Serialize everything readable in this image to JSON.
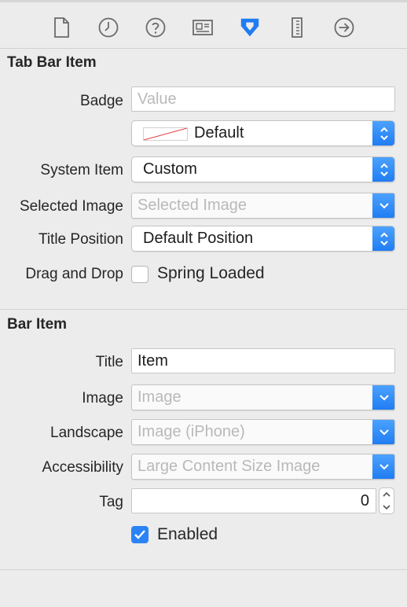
{
  "toolbar": {
    "icons": [
      "file-icon",
      "clock-icon",
      "help-icon",
      "identity-icon",
      "attributes-icon",
      "ruler-icon",
      "connections-icon"
    ],
    "active": "attributes-icon",
    "accent": "#1f7cf2"
  },
  "tab_bar_item": {
    "title": "Tab Bar Item",
    "badge_label": "Badge",
    "badge_placeholder": "Value",
    "badge_color_value": "Default",
    "system_item_label": "System Item",
    "system_item_value": "Custom",
    "selected_image_label": "Selected Image",
    "selected_image_placeholder": "Selected Image",
    "title_position_label": "Title Position",
    "title_position_value": "Default Position",
    "drag_drop_label": "Drag and Drop",
    "spring_loaded_label": "Spring Loaded",
    "spring_loaded_checked": false
  },
  "bar_item": {
    "title": "Bar Item",
    "title_label": "Title",
    "title_value": "Item",
    "image_label": "Image",
    "image_placeholder": "Image",
    "landscape_label": "Landscape",
    "landscape_placeholder": "Image (iPhone)",
    "accessibility_label": "Accessibility",
    "accessibility_placeholder": "Large Content Size Image",
    "tag_label": "Tag",
    "tag_value": "0",
    "enabled_label": "Enabled",
    "enabled_checked": true
  }
}
